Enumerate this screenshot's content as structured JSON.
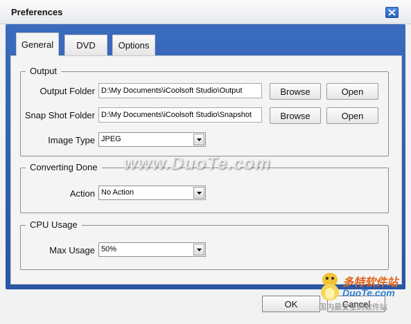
{
  "window": {
    "title": "Preferences",
    "close_icon": "close-icon"
  },
  "tabs": [
    {
      "label": "General",
      "active": true
    },
    {
      "label": "DVD",
      "active": false
    },
    {
      "label": "Options",
      "active": false
    }
  ],
  "output": {
    "legend": "Output",
    "output_folder": {
      "label": "Output Folder",
      "value": "D:\\My Documents\\iCoolsoft Studio\\Output",
      "browse": "Browse",
      "open": "Open"
    },
    "snapshot_folder": {
      "label": "Snap Shot Folder",
      "value": "D:\\My Documents\\iCoolsoft Studio\\Snapshot",
      "browse": "Browse",
      "open": "Open"
    },
    "image_type": {
      "label": "Image Type",
      "value": "JPEG"
    }
  },
  "converting_done": {
    "legend": "Converting Done",
    "action": {
      "label": "Action",
      "value": "No Action"
    }
  },
  "cpu_usage": {
    "legend": "CPU Usage",
    "max_usage": {
      "label": "Max Usage",
      "value": "50%"
    }
  },
  "footer": {
    "ok": "OK",
    "cancel": "Cancel"
  },
  "watermark": {
    "text": "www.DuoTe.com"
  },
  "logo": {
    "line1": "多特软件站",
    "line2": "DuoTe.com",
    "line3": "国内最安全的软件站"
  },
  "colors": {
    "frame": "#2f5fb3",
    "close": "#2f6ad0"
  }
}
